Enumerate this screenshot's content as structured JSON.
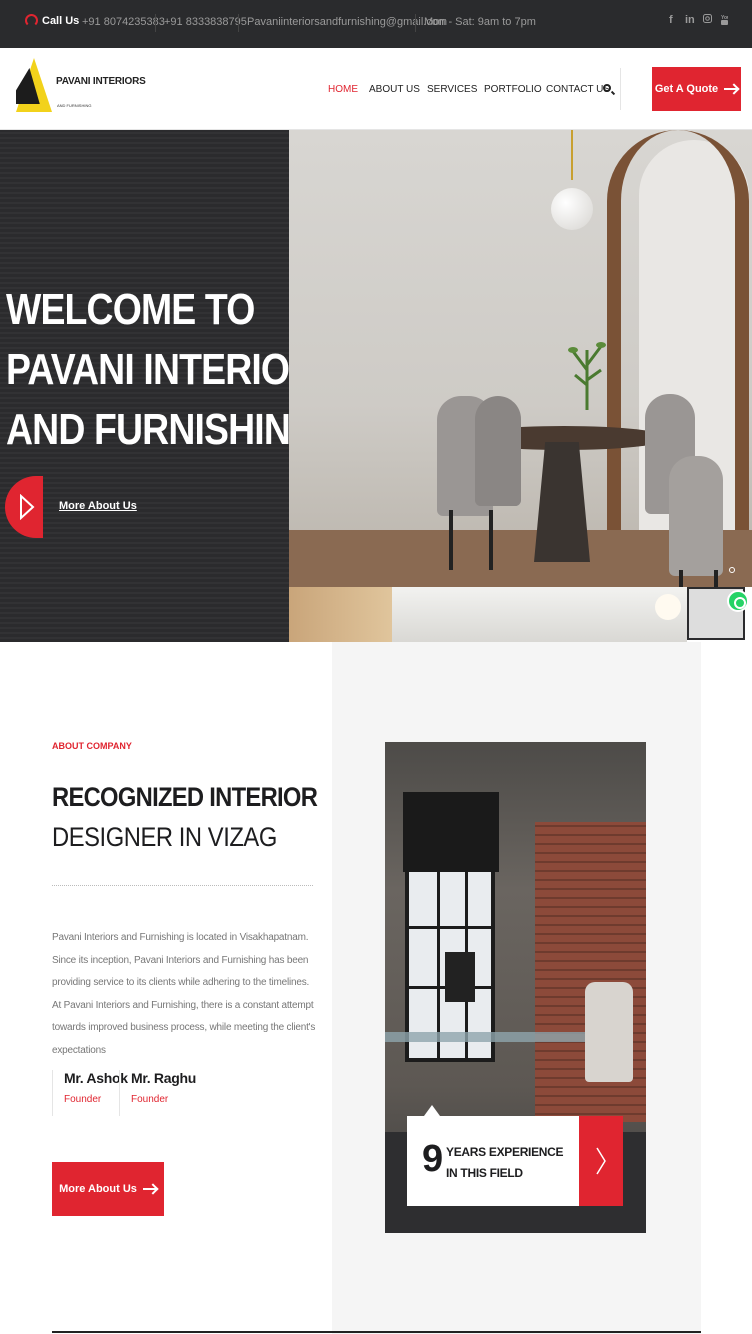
{
  "topbar": {
    "call_label": "Call Us",
    "phone1": "+91 8074235383",
    "phone2": "+91 8333838795",
    "email": "Pavaniinteriorsandfurnishing@gmail.com",
    "hours": "Mon - Sat: 9am to 7pm",
    "social": [
      "f",
      "in",
      "ig",
      "yt"
    ]
  },
  "brand": {
    "name": "PAVANI INTERIORS",
    "sub": "AND FURNISHING",
    "colors": {
      "accent": "#e02530",
      "yellow": "#f2d21b",
      "dark": "#2a2b2d"
    }
  },
  "nav": {
    "items": [
      "HOME",
      "ABOUT US",
      "SERVICES",
      "PORTFOLIO",
      "CONTACT US"
    ],
    "active": "HOME",
    "cta": "Get A Quote"
  },
  "hero": {
    "title_line1": "WELCOME TO",
    "title_line2": "PAVANI INTERIORS",
    "title_line3": "AND FURNISHING.",
    "more_link": "More About Us"
  },
  "about": {
    "tag": "ABOUT COMPANY",
    "heading_bold": "RECOGNIZED INTERIOR",
    "heading_light": "DESIGNER IN VIZAG",
    "body": "Pavani Interiors and Furnishing is located in Visakhapatnam. Since its inception, Pavani Interiors and Furnishing has been providing service to its clients while adhering to the timelines. At Pavani Interiors and Furnishing, there is a constant attempt towards improved business process, while meeting the client's expectations",
    "founders": [
      {
        "name": "Mr. Ashok",
        "role": "Founder"
      },
      {
        "name": "Mr. Raghu",
        "role": "Founder"
      }
    ],
    "button": "More About Us"
  },
  "experience": {
    "years": "9",
    "line1": "YEARS EXPERIENCE",
    "line2": "IN THIS FIELD"
  }
}
